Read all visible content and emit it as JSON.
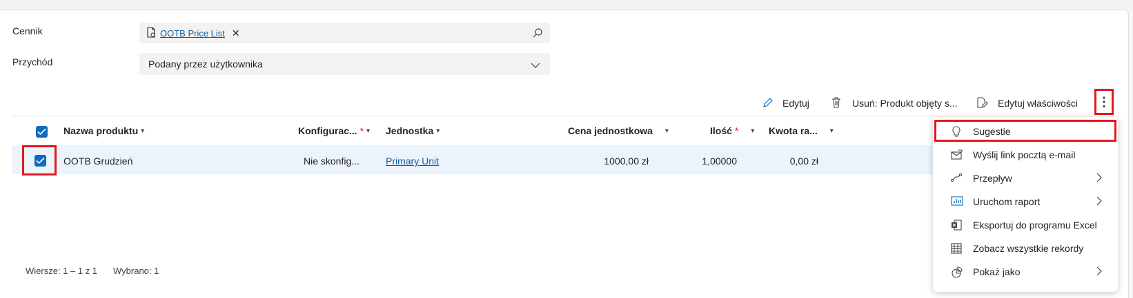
{
  "form": {
    "cennik_label": "Cennik",
    "cennik_value": "OOTB Price List",
    "przychod_label": "Przychód",
    "przychod_value": "Podany przez użytkownika"
  },
  "commandbar": {
    "edit": "Edytuj",
    "delete": "Usuń: Produkt objęty s...",
    "edit_props": "Edytuj właściwości"
  },
  "grid": {
    "headers": {
      "name": "Nazwa produktu",
      "config": "Konfigurac...",
      "unit": "Jednostka",
      "price": "Cena jednostkowa",
      "qty": "Ilość",
      "amount": "Kwota ra..."
    },
    "rows": [
      {
        "name": "OOTB Grudzień",
        "config": "Nie skonfig...",
        "unit": "Primary Unit",
        "price": "1000,00 zł",
        "qty": "1,00000",
        "amount": "0,00 zł"
      }
    ]
  },
  "footer": {
    "rows": "Wiersze: 1 – 1 z 1",
    "selected": "Wybrano: 1"
  },
  "menu": {
    "items": [
      {
        "label": "Sugestie",
        "icon": "lightbulb-icon"
      },
      {
        "label": "Wyślij link pocztą e-mail",
        "icon": "email-link-icon"
      },
      {
        "label": "Przepływ",
        "icon": "flow-icon"
      },
      {
        "label": "Uruchom raport",
        "icon": "report-icon"
      },
      {
        "label": "Eksportuj do programu Excel",
        "icon": "excel-icon"
      },
      {
        "label": "Zobacz wszystkie rekordy",
        "icon": "table-icon"
      },
      {
        "label": "Pokaż jako",
        "icon": "chart-pie-icon"
      }
    ]
  },
  "colors": {
    "accent": "#0f6cbd",
    "highlight": "#e3171f",
    "row_selected": "#ebf3fc"
  }
}
